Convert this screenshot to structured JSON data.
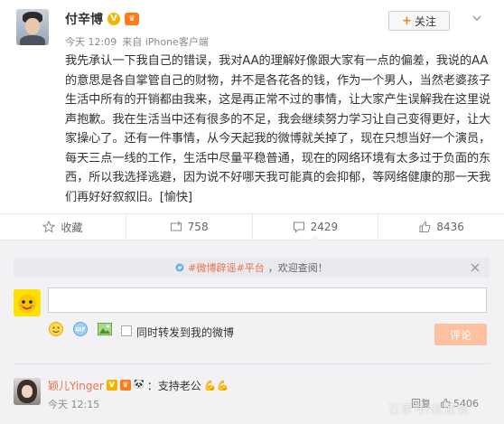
{
  "post": {
    "author": "付辛博",
    "time": "今天 12:09",
    "source": "来自 iPhone客户端",
    "follow_label": "关注",
    "content": "我先承认一下我自己的错误，我对AA的理解好像跟大家有一点的偏差，我说的AA的意思是各自掌管自己的财物，并不是各花各的钱，作为一个男人，当然老婆孩子生活中所有的开销都由我来，这是再正常不过的事情，让大家产生误解我在这里说声抱歉。我在生活当中还有很多的不足，我会继续努力学习让自己变得更好，让大家操心了。还有一件事情，从今天起我的微博就关掉了，现在只想当好一个演员，每天三点一线的工作，生活中尽量平稳普通，现在的网络环境有太多过于负面的东西，所以我选择逃避，因为说不好哪天我可能真的会抑郁，等网络健康的那一天我们再好好叙叙旧。[愉快]"
  },
  "actions": {
    "favorite_label": "收藏",
    "repost_count": "758",
    "comment_count": "2429",
    "like_count": "8436"
  },
  "comment_box": {
    "notice_tag": "#微博辟谣#平台",
    "notice_text": "，欢迎查阅！",
    "input_value": "",
    "repost_label": "同时转发到我的微博",
    "submit_label": "评论"
  },
  "comments": [
    {
      "user": "颖儿Yinger",
      "text": "：支持老公",
      "time": "今天 12:15",
      "reply_label": "回复",
      "likes": "5406"
    }
  ],
  "watermark": "百家号/极速娱",
  "colors": {
    "accent": "#eb7350",
    "follow_plus": "#ff8200",
    "verified": "#f5b400",
    "submit_disabled": "#ffc09f",
    "comment_bg": "#f2f2f5"
  }
}
